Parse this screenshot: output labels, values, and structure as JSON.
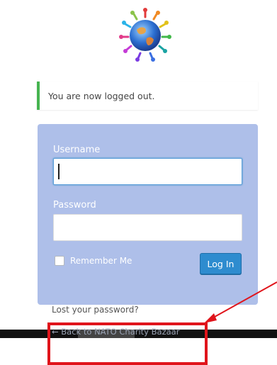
{
  "notice": {
    "message": "You are now logged out."
  },
  "form": {
    "username_label": "Username",
    "username_value": "",
    "password_label": "Password",
    "password_value": "",
    "remember_label": "Remember Me",
    "remember_checked": false,
    "login_button": "Log In"
  },
  "links": {
    "lost_password": "Lost your password?",
    "back_to_site": "← Back to NATO Charity Bazaar"
  },
  "colors": {
    "notice_border": "#46b450",
    "panel_background": "#aebfe9",
    "button": "#2e8ccf",
    "highlight": "#e0141b"
  },
  "icons": [
    "site-logo-globe-icon",
    "annotation-arrow-icon"
  ]
}
